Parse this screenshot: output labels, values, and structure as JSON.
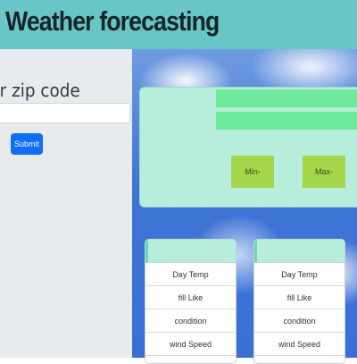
{
  "header": {
    "title": "Weather forecasting"
  },
  "sidebar": {
    "zip_label": "ur zip code",
    "zip_input": {
      "value": "",
      "placeholder": ""
    },
    "submit_label": "Submit"
  },
  "weather": {
    "min_label": "Min-",
    "max_label": "Max-"
  },
  "detail_cards": [
    {
      "rows": [
        "Day Temp",
        "fill Like",
        "condition",
        "wind Speed"
      ]
    },
    {
      "rows": [
        "Day Temp",
        "fill Like",
        "condition",
        "wind Speed"
      ]
    }
  ],
  "colors": {
    "header_bg": "#68c6c6",
    "sidebar_bg": "#e7ebee",
    "submit_bg": "#0d6efd",
    "card_bg": "#b7eddb",
    "bar_green": "#6eea9c",
    "minmax_button_bg": "#a3d648"
  }
}
